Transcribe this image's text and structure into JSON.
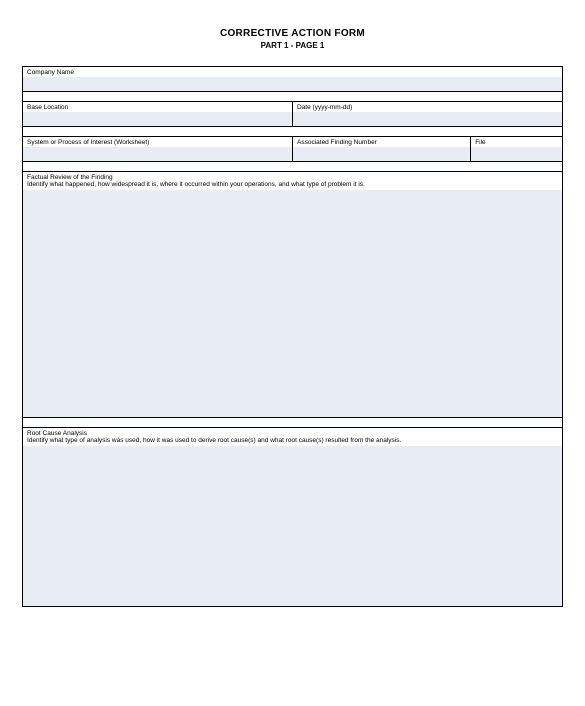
{
  "header": {
    "title": "CORRECTIVE ACTION FORM",
    "subtitle": "PART 1 - PAGE 1"
  },
  "fields": {
    "company_name": {
      "label": "Company Name",
      "value": ""
    },
    "base_location": {
      "label": "Base Location",
      "value": ""
    },
    "date": {
      "label": "Date (yyyy-mm-dd)",
      "value": ""
    },
    "system_process": {
      "label": "System or Process of Interest (Worksheet)",
      "value": ""
    },
    "finding_number": {
      "label": "Associated Finding Number",
      "value": ""
    },
    "file": {
      "label": "File",
      "value": ""
    }
  },
  "sections": {
    "factual_review": {
      "title": "Factual Review of the Finding",
      "instruction": "Identify what happened, how widespread it is, where it occurred within your operations, and what type of problem it is.",
      "value": ""
    },
    "root_cause": {
      "title": "Root Cause Analysis",
      "instruction": "Identify what type of analysis was used, how it was used to derive root cause(s) and what root cause(s) resulted from the analysis.",
      "value": ""
    }
  }
}
